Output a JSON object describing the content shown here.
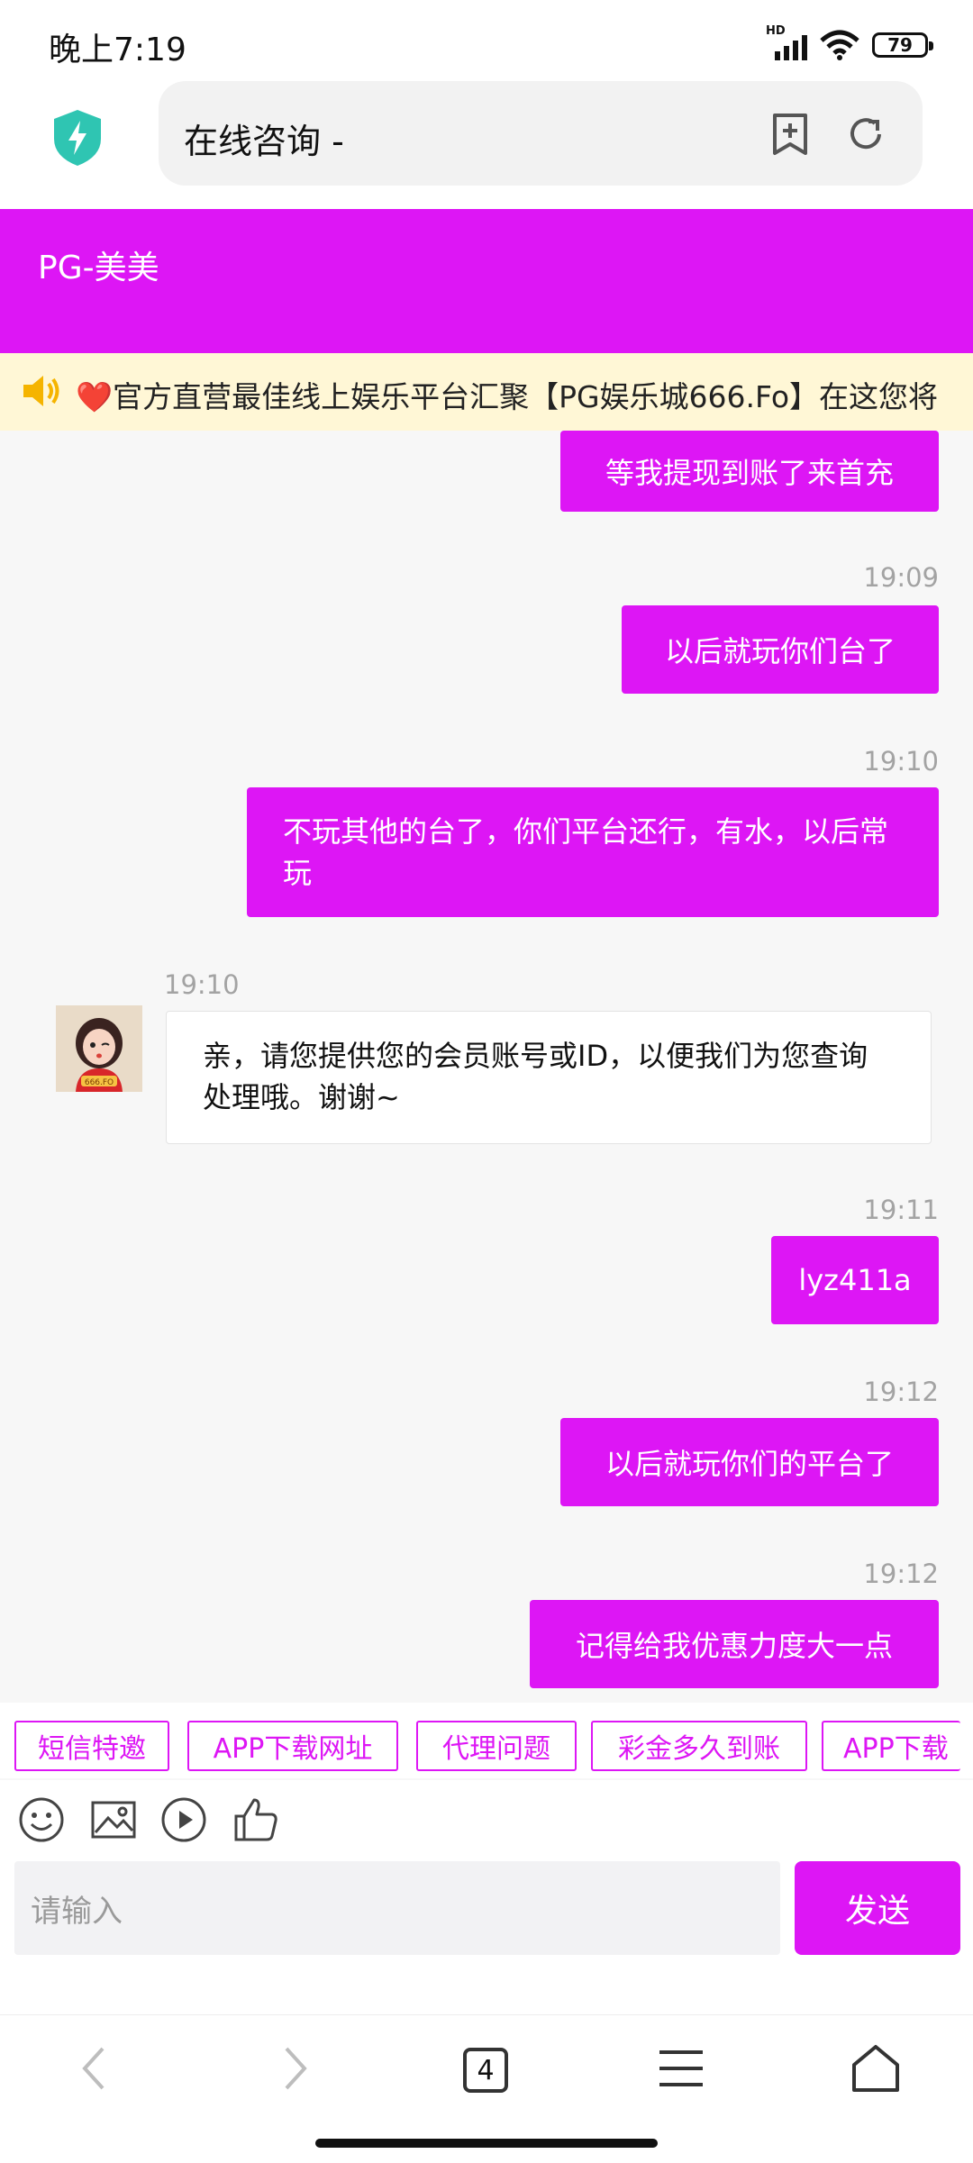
{
  "status_bar": {
    "time": "晚上7:19",
    "network": "HD",
    "battery": "79"
  },
  "browser": {
    "url_title": "在线咨询 -",
    "tab_count": "4"
  },
  "chat": {
    "agent_name": "PG-美美",
    "marquee": "❤️官方直营最佳线上娱乐平台汇聚【PG娱乐城666.Fo】在这您将",
    "messages": [
      {
        "side": "right",
        "time": "",
        "text": "等我提现到账了来首充"
      },
      {
        "side": "right",
        "time": "19:09",
        "text": "以后就玩你们台了"
      },
      {
        "side": "right",
        "time": "19:10",
        "text": "不玩其他的台了，你们平台还行，有水，以后常玩"
      },
      {
        "side": "left",
        "time": "19:10",
        "text": "亲，请您提供您的会员账号或ID，以便我们为您查询处理哦。谢谢~"
      },
      {
        "side": "right",
        "time": "19:11",
        "text": "lyz411a"
      },
      {
        "side": "right",
        "time": "19:12",
        "text": "以后就玩你们的平台了"
      },
      {
        "side": "right",
        "time": "19:12",
        "text": "记得给我优惠力度大一点"
      }
    ],
    "avatar_label": "666.FO"
  },
  "quick_replies": [
    "短信特邀",
    "APP下载网址",
    "代理问题",
    "彩金多久到账",
    "APP下载"
  ],
  "toolbar_icons": [
    "emoji-icon",
    "image-icon",
    "video-icon",
    "thumbs-up-icon"
  ],
  "input": {
    "placeholder": "请输入",
    "send_label": "发送"
  },
  "colors": {
    "accent": "#dd16f5",
    "marquee_bg": "#fff7d6",
    "shield": "#2fc5b2"
  }
}
